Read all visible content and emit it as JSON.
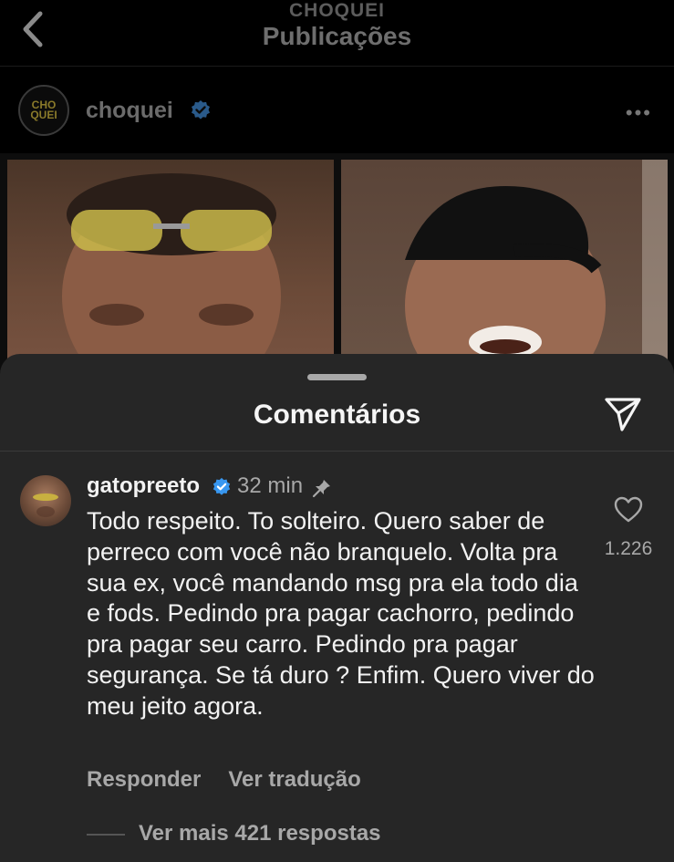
{
  "header": {
    "account_label": "CHOQUEI",
    "title": "Publicações"
  },
  "post": {
    "username": "choquei",
    "avatar_text": "CHO QUEI"
  },
  "comments_sheet": {
    "title": "Comentários"
  },
  "comment": {
    "username": "gatopreeto",
    "time": "32 min",
    "text": "Todo respeito. To solteiro. Quero saber de perreco com você não branquelo. Volta pra sua ex, você mandando msg pra ela todo dia e fods. Pedindo pra pagar cachorro, pedindo pra pagar seu carro. Pedindo pra pagar segurança. Se tá duro ? Enfim. Quero viver do meu jeito agora.",
    "likes": "1.226",
    "reply_label": "Responder",
    "translate_label": "Ver tradução",
    "more_replies_label": "Ver mais 421 respostas"
  },
  "colors": {
    "background": "#000000",
    "sheet": "#262626",
    "verified": "#3897f0",
    "muted": "#a8a8a8"
  },
  "icons": [
    "back-chevron-icon",
    "verified-badge-icon",
    "more-dots-icon",
    "share-send-icon",
    "pin-icon",
    "heart-icon"
  ]
}
